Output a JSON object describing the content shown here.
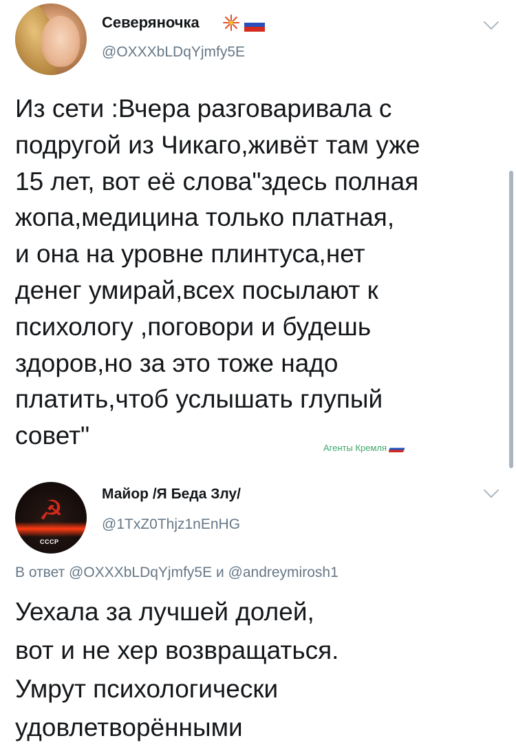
{
  "tweet1": {
    "display_name": "Северяночка",
    "handle": "@OXXXbLDqYjmfy5E",
    "text": "Из сети :Вчера разговаривала с\nподругой из Чикаго,живёт там уже\n15 лет, вот её слова\"здесь полная\nжопа,медицина только платная,\nи она на уровне плинтуса,нет\nденег умирай,всех посылают к\nпсихологу ,поговори и будешь\nздоров,но за это тоже надо\nплатить,чтоб услышать глупый\nсовет\""
  },
  "watermark": "Агенты Кремля",
  "tweet2": {
    "display_name": "Майор /Я Беда Злу/",
    "handle": "@1TxZ0Thjz1nEnHG",
    "reply_prefix": "В ответ",
    "reply_mention_1": "@OXXXbLDqYjmfy5E",
    "reply_and": "и",
    "reply_mention_2": "@andreymirosh1",
    "text": "Уехала за лучшей долей,\nвот и не хер возвращаться.\nУмрут психологически\nудовлетворёнными",
    "avatar_caption": "СССР"
  },
  "icons": {
    "badge_1": "firework-emoji-icon",
    "badge_2": "russia-flag-icon",
    "more": "chevron-down-icon"
  },
  "colors": {
    "text_primary": "#14171a",
    "text_secondary": "#657786",
    "watermark_green": "#3fa66b"
  }
}
